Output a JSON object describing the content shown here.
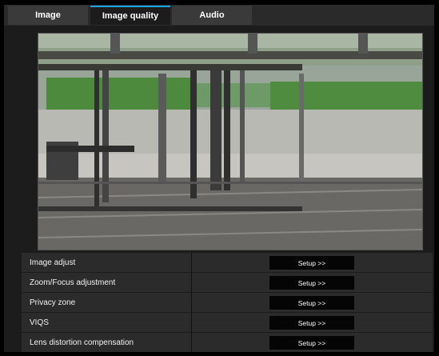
{
  "tabs": [
    {
      "label": "Image",
      "active": false
    },
    {
      "label": "Image quality",
      "active": true
    },
    {
      "label": "Audio",
      "active": false
    }
  ],
  "colors": {
    "accent": "#1ca3e0",
    "background": "#000000",
    "panel": "#1c1c1c",
    "row": "#2b2b2b"
  },
  "settings": [
    {
      "label": "Image adjust",
      "button": "Setup >>"
    },
    {
      "label": "Zoom/Focus adjustment",
      "button": "Setup >>"
    },
    {
      "label": "Privacy zone",
      "button": "Setup >>"
    },
    {
      "label": "VIQS",
      "button": "Setup >>"
    },
    {
      "label": "Lens distortion compensation",
      "button": "Setup >>"
    }
  ]
}
